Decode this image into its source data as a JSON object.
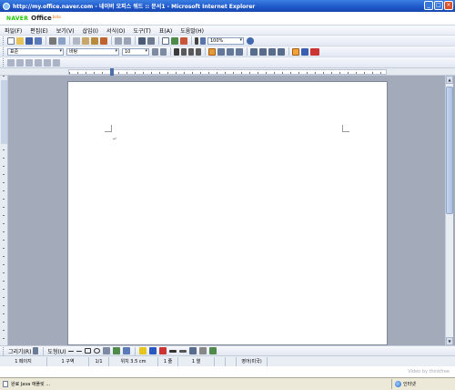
{
  "window": {
    "title": "http://my.office.naver.com - 네이버 오피스 워드 :: 문서1 - Microsoft Internet Explorer",
    "minimize_symbol": "_",
    "maximize_symbol": "□",
    "close_symbol": "×"
  },
  "brand": {
    "naver": "NAVER",
    "office": "Office",
    "beta": "beta"
  },
  "menu": {
    "items": [
      "파일(F)",
      "편집(E)",
      "보기(V)",
      "삽입(I)",
      "서식(O)",
      "도구(T)",
      "표(A)",
      "도움말(H)"
    ]
  },
  "toolbar1": {
    "zoom_value": "100%"
  },
  "toolbar2": {
    "style_value": "표준",
    "font_value": "바탕",
    "size_value": "10"
  },
  "draw_toolbar": {
    "draw_label": "그리기(R)",
    "autoshape_label": "도형(U)"
  },
  "doc_status": {
    "page": "1 페이지",
    "section": "1 구역",
    "page_of": "1/1",
    "position": "위치 3.5 cm",
    "line": "1 줄",
    "column": "1 열",
    "language": "영어(미국)"
  },
  "ie_status": {
    "message": "완료 Java 애플릿 ...",
    "zone": "인터넷"
  },
  "watermark": "Video by thinkfree",
  "colors": {
    "titlebar": "#1f57c9",
    "naver_green": "#1ec800",
    "workspace": "#a3abba"
  },
  "icons": {
    "toolbar1": [
      "new-doc-icon",
      "open-icon",
      "save-icon",
      "save-as-icon",
      "print-icon",
      "preview-icon",
      "cut-icon",
      "copy-icon",
      "paste-icon",
      "format-painter-icon",
      "undo-icon",
      "redo-icon",
      "find-icon",
      "zoom-tool-icon",
      "table-icon",
      "insert-picture-icon",
      "chart-icon",
      "show-marks-icon",
      "info-icon",
      "help-icon"
    ],
    "toolbar2": [
      "font-grow-icon",
      "font-shrink-icon",
      "bold-icon",
      "italic-icon",
      "underline-icon",
      "strike-icon",
      "align-left-icon",
      "align-center-icon",
      "align-right-icon",
      "justify-icon",
      "numbered-list-icon",
      "bullet-list-icon",
      "outdent-icon",
      "indent-icon",
      "highlight-icon",
      "font-color-icon"
    ]
  }
}
